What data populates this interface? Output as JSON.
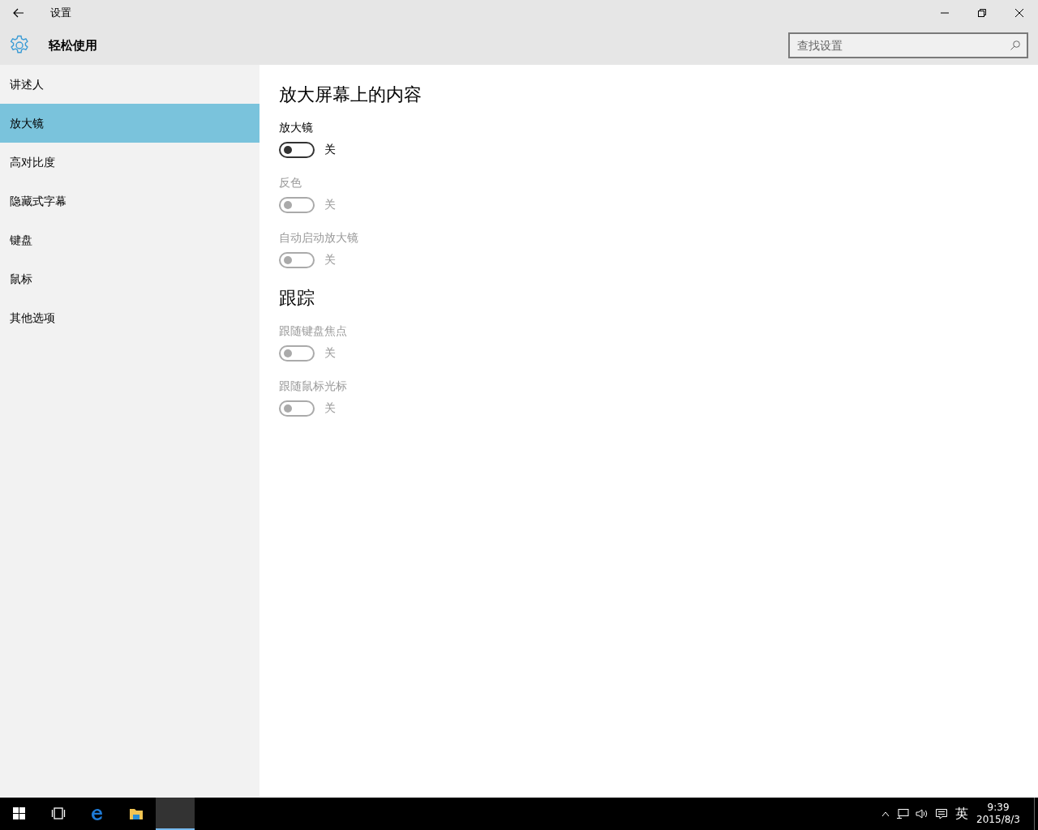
{
  "window": {
    "title": "设置"
  },
  "header": {
    "title": "轻松使用"
  },
  "search": {
    "placeholder": "查找设置"
  },
  "sidebar": {
    "items": [
      {
        "label": "讲述人",
        "selected": false
      },
      {
        "label": "放大镜",
        "selected": true
      },
      {
        "label": "高对比度",
        "selected": false
      },
      {
        "label": "隐藏式字幕",
        "selected": false
      },
      {
        "label": "键盘",
        "selected": false
      },
      {
        "label": "鼠标",
        "selected": false
      },
      {
        "label": "其他选项",
        "selected": false
      }
    ]
  },
  "sections": [
    {
      "heading": "放大屏幕上的内容",
      "settings": [
        {
          "label": "放大镜",
          "on": false,
          "disabled": false,
          "state_text": "关"
        },
        {
          "label": "反色",
          "on": false,
          "disabled": true,
          "state_text": "关"
        },
        {
          "label": "自动启动放大镜",
          "on": false,
          "disabled": true,
          "state_text": "关"
        }
      ]
    },
    {
      "heading": "跟踪",
      "settings": [
        {
          "label": "跟随键盘焦点",
          "on": false,
          "disabled": true,
          "state_text": "关"
        },
        {
          "label": "跟随鼠标光标",
          "on": false,
          "disabled": true,
          "state_text": "关"
        }
      ]
    }
  ],
  "taskbar": {
    "apps": [
      {
        "kind": "start",
        "active": false
      },
      {
        "kind": "taskview",
        "active": false
      },
      {
        "kind": "browser",
        "active": false
      },
      {
        "kind": "folder",
        "active": false
      },
      {
        "kind": "settings",
        "active": true
      }
    ]
  },
  "tray": {
    "language": "英",
    "time": "9:39",
    "date": "2015/8/3"
  }
}
